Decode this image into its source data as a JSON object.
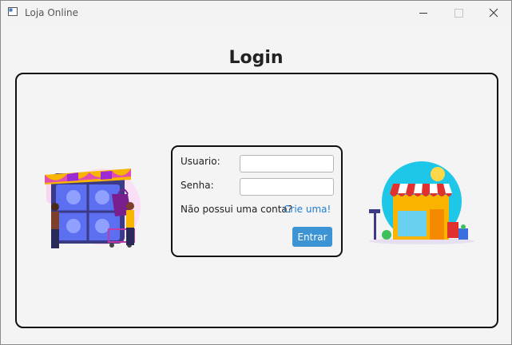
{
  "window": {
    "title": "Loja Online"
  },
  "page": {
    "heading": "Login"
  },
  "form": {
    "username_label": "Usuario:",
    "username_value": "",
    "password_label": "Senha:",
    "password_value": "",
    "no_account_text": "Não possui uma conta?",
    "signup_link": "Crie uma!",
    "submit_label": "Entrar"
  },
  "colors": {
    "accent": "#3d94d4",
    "link": "#1f7dd4"
  },
  "icons": [
    "app-icon",
    "minimize-icon",
    "maximize-icon",
    "close-icon",
    "phone-shop-illustration",
    "storefront-illustration"
  ]
}
